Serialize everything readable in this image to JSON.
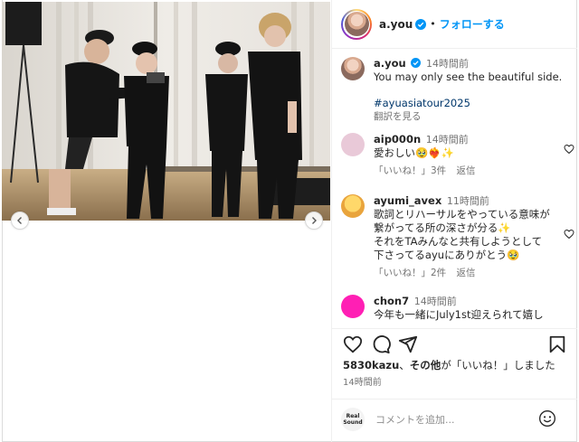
{
  "post": {
    "username": "a.you",
    "follow_label": "フォローする",
    "separator": "•"
  },
  "caption": {
    "username": "a.you",
    "time": "14時間前",
    "text": "You may only see the beautiful side.",
    "hashtag": "#ayuasiatour2025",
    "translate_label": "翻訳を見る"
  },
  "comments": [
    {
      "username": "aip000n",
      "time": "14時間前",
      "text": "愛おしい🥹❤️‍🔥✨",
      "like_label": "「いいね！」3件",
      "reply_label": "返信",
      "avatar_color": "#e9c9d8"
    },
    {
      "username": "ayumi_avex",
      "time": "11時間前",
      "lines": [
        "歌詞とリハーサルをやっている意味が",
        "繋がってる所の深さが分る✨",
        "それをTAみんなと共有しようとして",
        "下さってるayuにありがとう🥹"
      ],
      "like_label": "「いいね！」2件",
      "reply_label": "返信",
      "avatar_color": "#f7c04a"
    },
    {
      "username": "chon7",
      "time": "14時間前",
      "text": "今年も一緒にJuly1st迎えられて嬉し",
      "avatar_color": "#ff1fb4"
    }
  ],
  "engagement": {
    "liker": "5830kazu",
    "mid": "、",
    "others": "その他",
    "suffix": "が「いいね！」しました",
    "time": "14時間前"
  },
  "comment_box": {
    "placeholder": "コメントを追加...",
    "avatar_text_top": "Real",
    "avatar_text_bottom": "Sound"
  },
  "colors": {
    "accent": "#0095f6",
    "muted": "#737373",
    "text": "#262626"
  },
  "icons": [
    "heart-icon",
    "comment-icon",
    "share-icon",
    "bookmark-icon",
    "emoji-icon",
    "chevron-left-icon",
    "chevron-right-icon",
    "verified-badge-icon"
  ]
}
